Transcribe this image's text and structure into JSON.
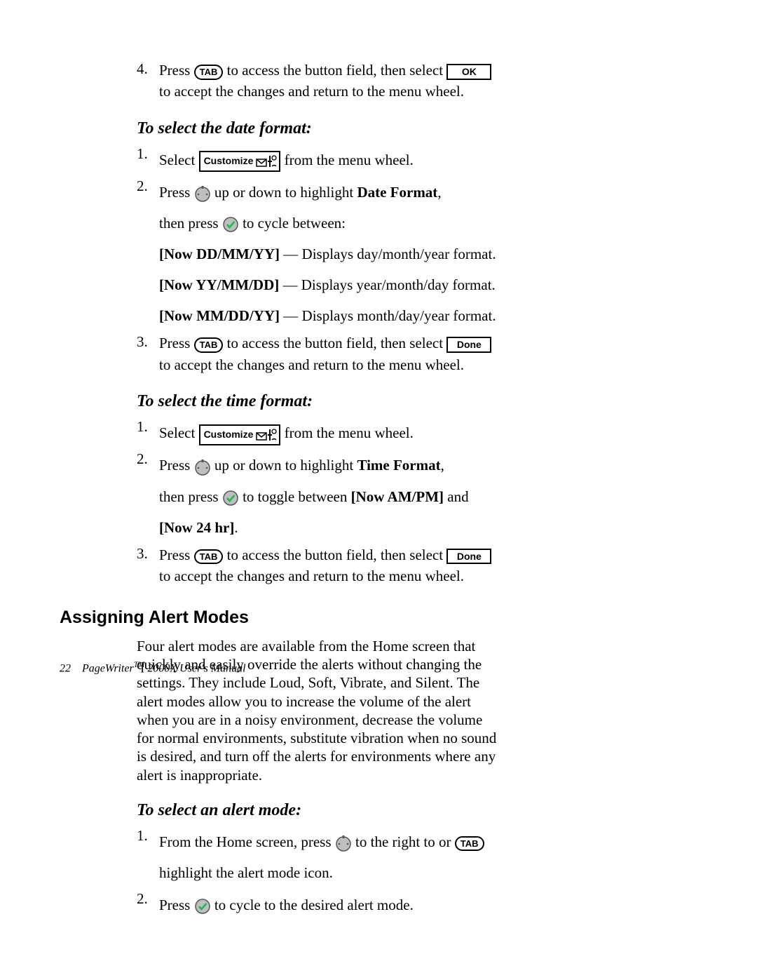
{
  "keys": {
    "tab": "TAB",
    "ok": "OK",
    "done": "Done",
    "customize": "Customize"
  },
  "step4": {
    "press": "Press ",
    "mid": " to access the button field, then select ",
    "cont": "to accept the changes and return to the menu wheel."
  },
  "sec_date": {
    "heading": "To select the date format:",
    "s1_a": "Select ",
    "s1_b": " from the menu wheel.",
    "s2_a": "Press ",
    "s2_b": " up or down to highlight ",
    "s2_bold": "Date Format",
    "s2_c": ",",
    "s2_d": "then press ",
    "s2_e": " to cycle between:",
    "opt1_a": "[Now DD/MM/YY]",
    "opt1_b": " — Displays day/month/year format.",
    "opt2_a": "[Now YY/MM/DD]",
    "opt2_b": " — Displays year/month/day format.",
    "opt3_a": "[Now MM/DD/YY]",
    "opt3_b": " — Displays month/day/year format.",
    "s3_a": "Press ",
    "s3_b": " to access the button field, then select ",
    "s3_c": "to accept the changes and return to the menu wheel."
  },
  "sec_time": {
    "heading": "To select the time format:",
    "s1_a": "Select ",
    "s1_b": " from the menu wheel.",
    "s2_a": "Press ",
    "s2_b": " up or down to highlight ",
    "s2_bold": "Time Format",
    "s2_c": ",",
    "s2_d": "then press ",
    "s2_e": " to toggle between ",
    "s2_f_bold": "[Now AM/PM]",
    "s2_g": " and ",
    "s2_h_bold": "[Now 24 hr]",
    "s2_i": ".",
    "s3_a": "Press ",
    "s3_b": " to access the button field, then select ",
    "s3_c": "to accept the changes and return to the menu wheel."
  },
  "sec_alert": {
    "heading": "Assigning Alert Modes",
    "para": "Four alert modes are available from the Home screen that quickly and easily override the alerts without changing the settings. They include Loud, Soft, Vibrate, and Silent. The alert modes allow you to increase the volume of the alert when you are in a noisy environment, decrease the volume for normal environments, substitute vibration when no sound is desired, and turn off the alerts for environments where any alert is inappropriate.",
    "sub": "To select an alert mode:",
    "s1_a": "From the Home screen, press ",
    "s1_b": " to the right to or ",
    "s1_c": "highlight the alert mode icon.",
    "s2_a": "Press ",
    "s2_b": " to cycle to the desired alert mode."
  },
  "footer": {
    "page": "22",
    "title_a": "PageWriter",
    "tm": "TM",
    "title_b": " 2000X User's Manual"
  }
}
